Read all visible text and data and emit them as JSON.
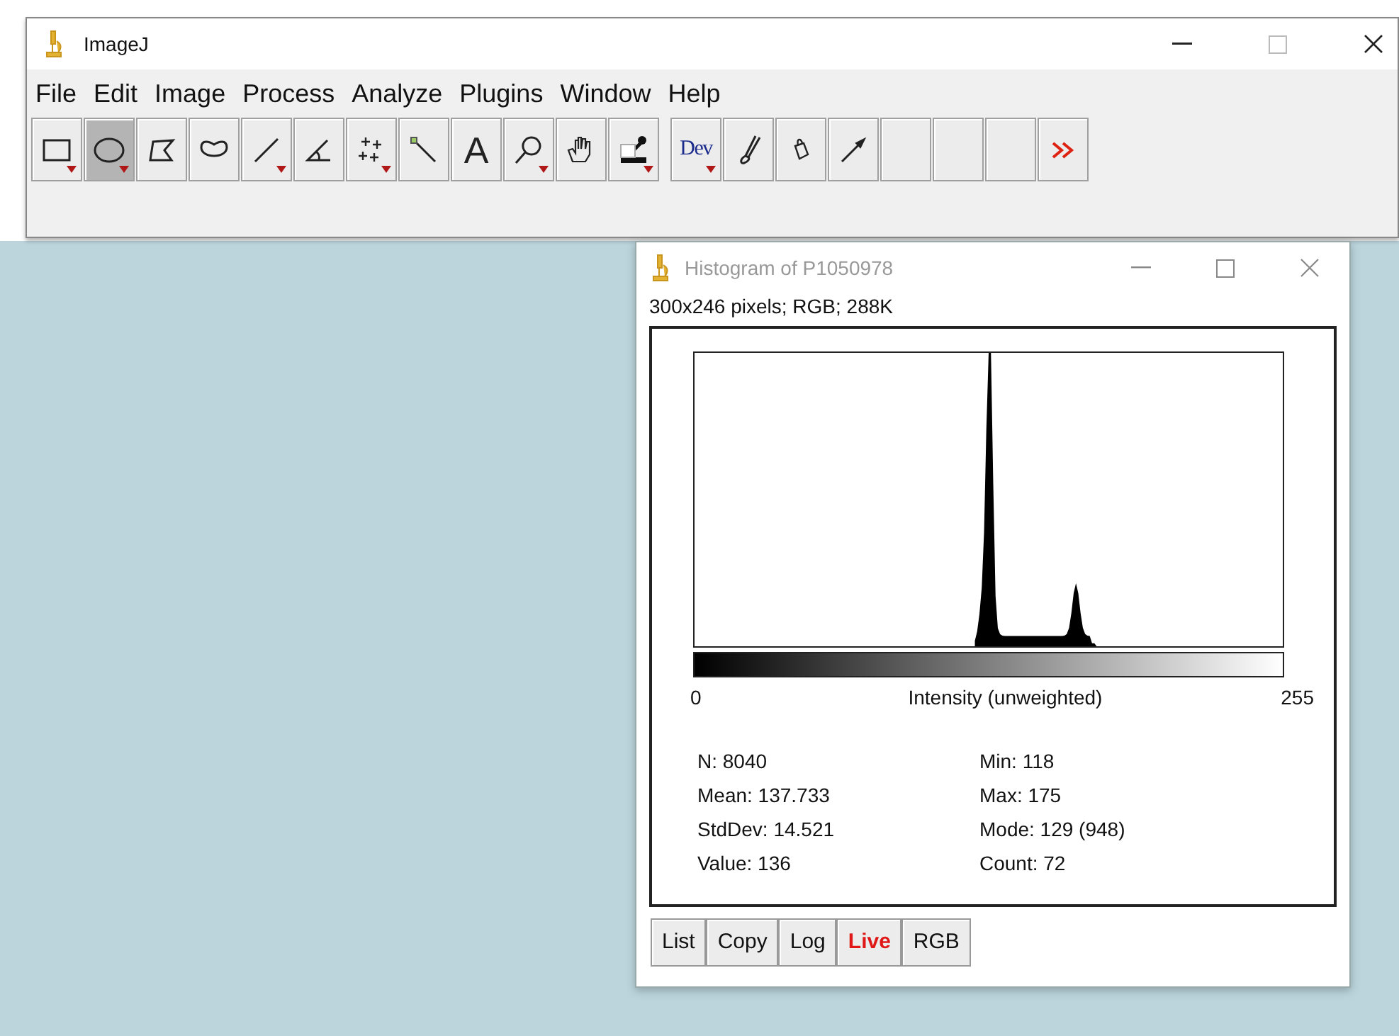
{
  "main_window": {
    "title": "ImageJ"
  },
  "menu": [
    "File",
    "Edit",
    "Image",
    "Process",
    "Analyze",
    "Plugins",
    "Window",
    "Help"
  ],
  "toolbar": [
    {
      "kind": "rectangle",
      "selected": false,
      "has_menu": true
    },
    {
      "kind": "oval",
      "selected": true,
      "has_menu": true
    },
    {
      "kind": "polygon",
      "selected": false,
      "has_menu": false
    },
    {
      "kind": "freehand",
      "selected": false,
      "has_menu": false
    },
    {
      "kind": "line",
      "selected": false,
      "has_menu": true
    },
    {
      "kind": "angle",
      "selected": false,
      "has_menu": false
    },
    {
      "kind": "multipoint",
      "selected": false,
      "has_menu": true
    },
    {
      "kind": "wand",
      "selected": false,
      "has_menu": false
    },
    {
      "kind": "text",
      "label": "A",
      "selected": false,
      "has_menu": false
    },
    {
      "kind": "zoom",
      "selected": false,
      "has_menu": true
    },
    {
      "kind": "hand",
      "selected": false,
      "has_menu": false
    },
    {
      "kind": "dropper",
      "selected": false,
      "has_menu": true
    },
    {
      "kind": "dev",
      "label": "Dev",
      "selected": false,
      "has_menu": true
    },
    {
      "kind": "brush",
      "selected": false,
      "has_menu": false
    },
    {
      "kind": "bucket",
      "selected": false,
      "has_menu": false
    },
    {
      "kind": "arrow",
      "selected": false,
      "has_menu": false
    },
    {
      "kind": "empty",
      "selected": false,
      "has_menu": false
    },
    {
      "kind": "empty",
      "selected": false,
      "has_menu": false
    },
    {
      "kind": "empty",
      "selected": false,
      "has_menu": false
    },
    {
      "kind": "more",
      "selected": false,
      "has_menu": false
    }
  ],
  "histogram_window": {
    "title": "Histogram of P1050978",
    "active": false,
    "info": "300x246 pixels; RGB; 288K",
    "axis_min": "0",
    "axis_label": "Intensity (unweighted)",
    "axis_max": "255",
    "stats_left": [
      "N: 8040",
      "Mean: 137.733",
      "StdDev: 14.521",
      "Value: 136"
    ],
    "stats_right": [
      "Min: 118",
      "Max: 175",
      "Mode: 129 (948)",
      "Count: 72"
    ],
    "buttons": [
      {
        "label": "List",
        "active": false
      },
      {
        "label": "Copy",
        "active": false
      },
      {
        "label": "Log",
        "active": false
      },
      {
        "label": "Live",
        "active": true
      },
      {
        "label": "RGB",
        "active": false
      }
    ]
  }
}
